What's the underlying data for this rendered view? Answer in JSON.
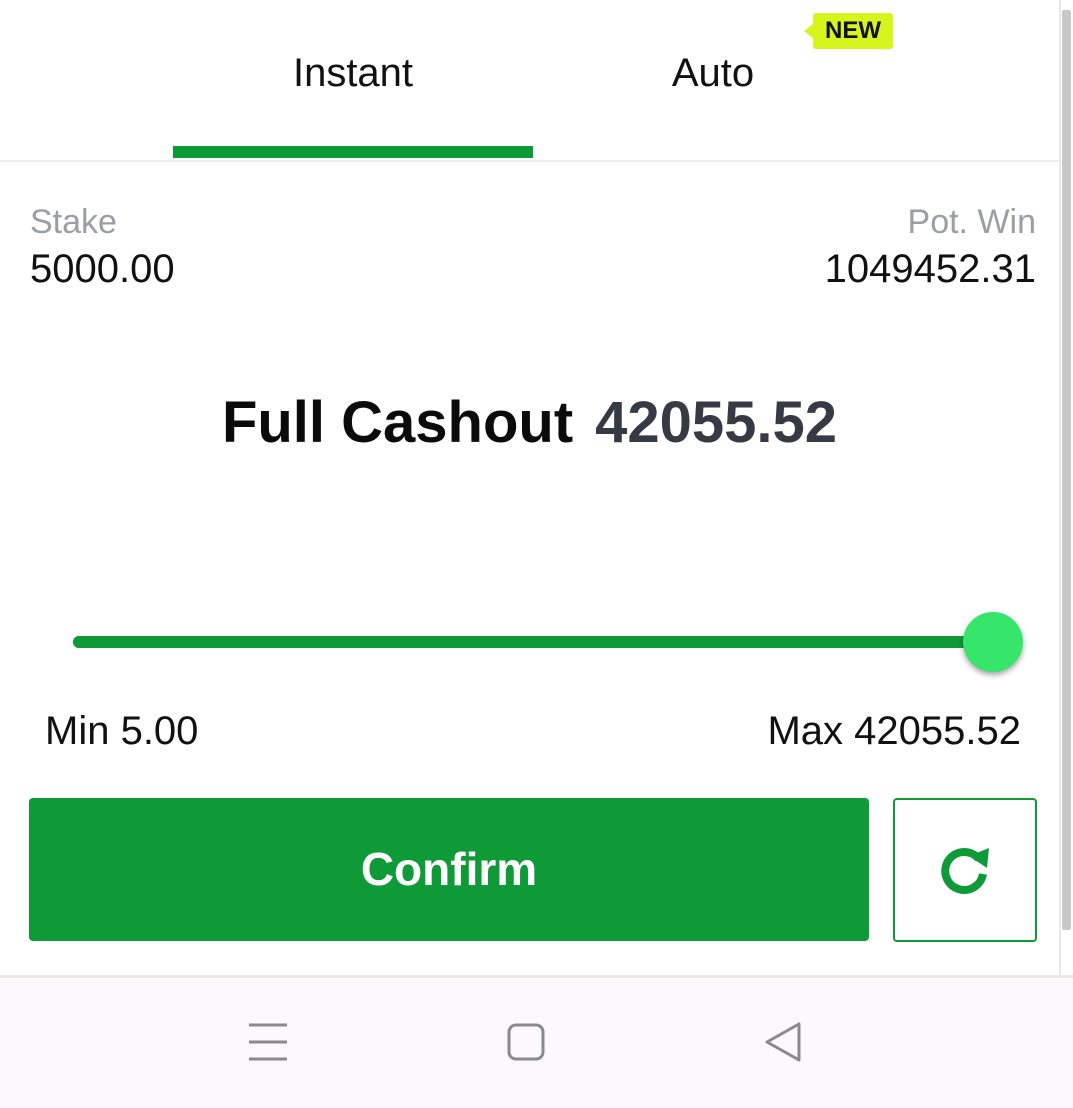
{
  "tabs": [
    {
      "label": "Instant",
      "active": true
    },
    {
      "label": "Auto",
      "active": false,
      "badge": "NEW"
    }
  ],
  "bet": {
    "stake_label": "Stake",
    "stake_value": "5000.00",
    "potwin_label": "Pot. Win",
    "potwin_value": "1049452.31"
  },
  "cashout": {
    "title": "Full Cashout",
    "amount": "42055.52"
  },
  "slider": {
    "min_label": "Min 5.00",
    "max_label": "Max 42055.52",
    "level": 1.0
  },
  "actions": {
    "confirm_label": "Confirm",
    "refresh_icon": "refresh-icon"
  },
  "system_nav": {
    "icons": [
      "menu-icon",
      "home-icon",
      "back-icon"
    ]
  },
  "colors": {
    "accent_green": "#0f9a38",
    "thumb_green": "#35e66a",
    "badge_yellow": "#d6f51d"
  }
}
